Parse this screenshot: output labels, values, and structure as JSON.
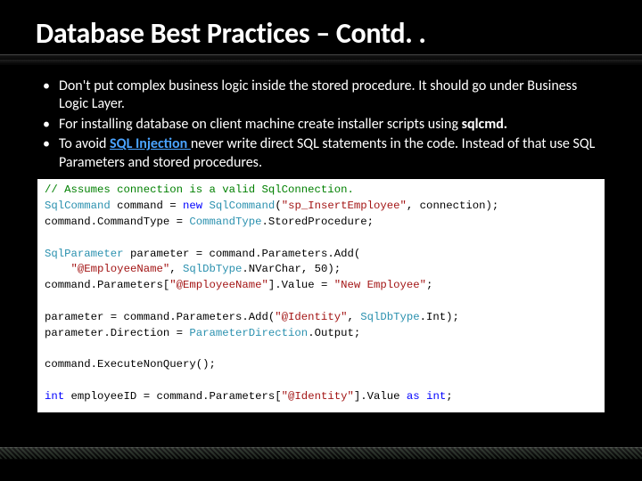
{
  "title": "Database Best Practices – Contd. .",
  "bullets": [
    {
      "pre": "Don't put complex business logic inside the stored procedure. It should go under Business Logic Layer."
    },
    {
      "pre": "For installing database on client machine create installer scripts using ",
      "bold": "sqlcmd.",
      "post": ""
    },
    {
      "pre": "To avoid ",
      "link": "SQL Injection ",
      "post": "never write direct SQL statements in the code. Instead of that use SQL Parameters and stored procedures."
    }
  ],
  "code": {
    "l1_comment": "// Assumes connection is a valid SqlConnection.",
    "l2a": " command = ",
    "l2_new": "new",
    "l2b": " ",
    "l2c": "(",
    "l2_str": "\"sp_InsertEmployee\"",
    "l2d": ", connection);",
    "l3a": "command.CommandType = ",
    "l3b": ".StoredProcedure;",
    "l5a": " parameter = command.Parameters.Add(",
    "l6_str1": "\"@EmployeeName\"",
    "l6a": ", ",
    "l6b": ".NVarChar, 50);",
    "l7a": "command.Parameters[",
    "l7_str": "\"@EmployeeName\"",
    "l7b": "].Value = ",
    "l7_str2": "\"New Employee\"",
    "l7c": ";",
    "l9a": "parameter = command.Parameters.Add(",
    "l9_str": "\"@Identity\"",
    "l9b": ", ",
    "l9c": ".Int);",
    "l10a": "parameter.Direction = ",
    "l10b": ".Output;",
    "l12a": "command.ExecuteNonQuery();",
    "l14_kw": "int",
    "l14a": " employeeID = command.Parameters[",
    "l14_str": "\"@Identity\"",
    "l14b": "].Value ",
    "l14_as": "as",
    "l14c": " ",
    "l14_kw2": "int",
    "l14d": ";",
    "type_SqlCommand": "SqlCommand",
    "type_CommandType": "CommandType",
    "type_SqlParameter": "SqlParameter",
    "type_SqlDbType": "SqlDbType",
    "type_ParameterDirection": "ParameterDirection"
  }
}
